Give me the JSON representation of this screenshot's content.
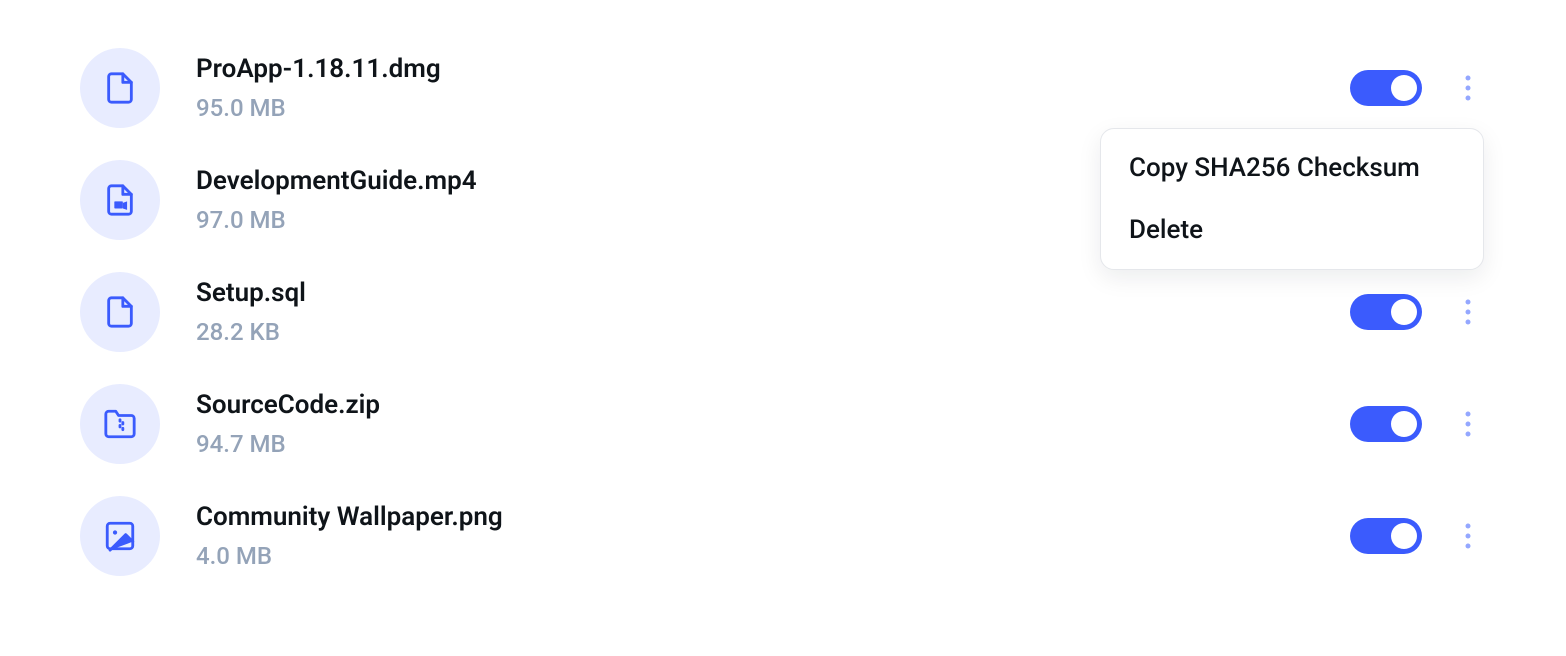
{
  "files": [
    {
      "name": "ProApp-1.18.11.dmg",
      "size": "95.0 MB",
      "icon": "file"
    },
    {
      "name": "DevelopmentGuide.mp4",
      "size": "97.0 MB",
      "icon": "video"
    },
    {
      "name": "Setup.sql",
      "size": "28.2 KB",
      "icon": "file"
    },
    {
      "name": "SourceCode.zip",
      "size": "94.7 MB",
      "icon": "archive"
    },
    {
      "name": "Community Wallpaper.png",
      "size": "4.0 MB",
      "icon": "image"
    }
  ],
  "popover": {
    "visible_for_index": 1,
    "items": [
      {
        "label": "Copy SHA256 Checksum"
      },
      {
        "label": "Delete"
      }
    ]
  }
}
